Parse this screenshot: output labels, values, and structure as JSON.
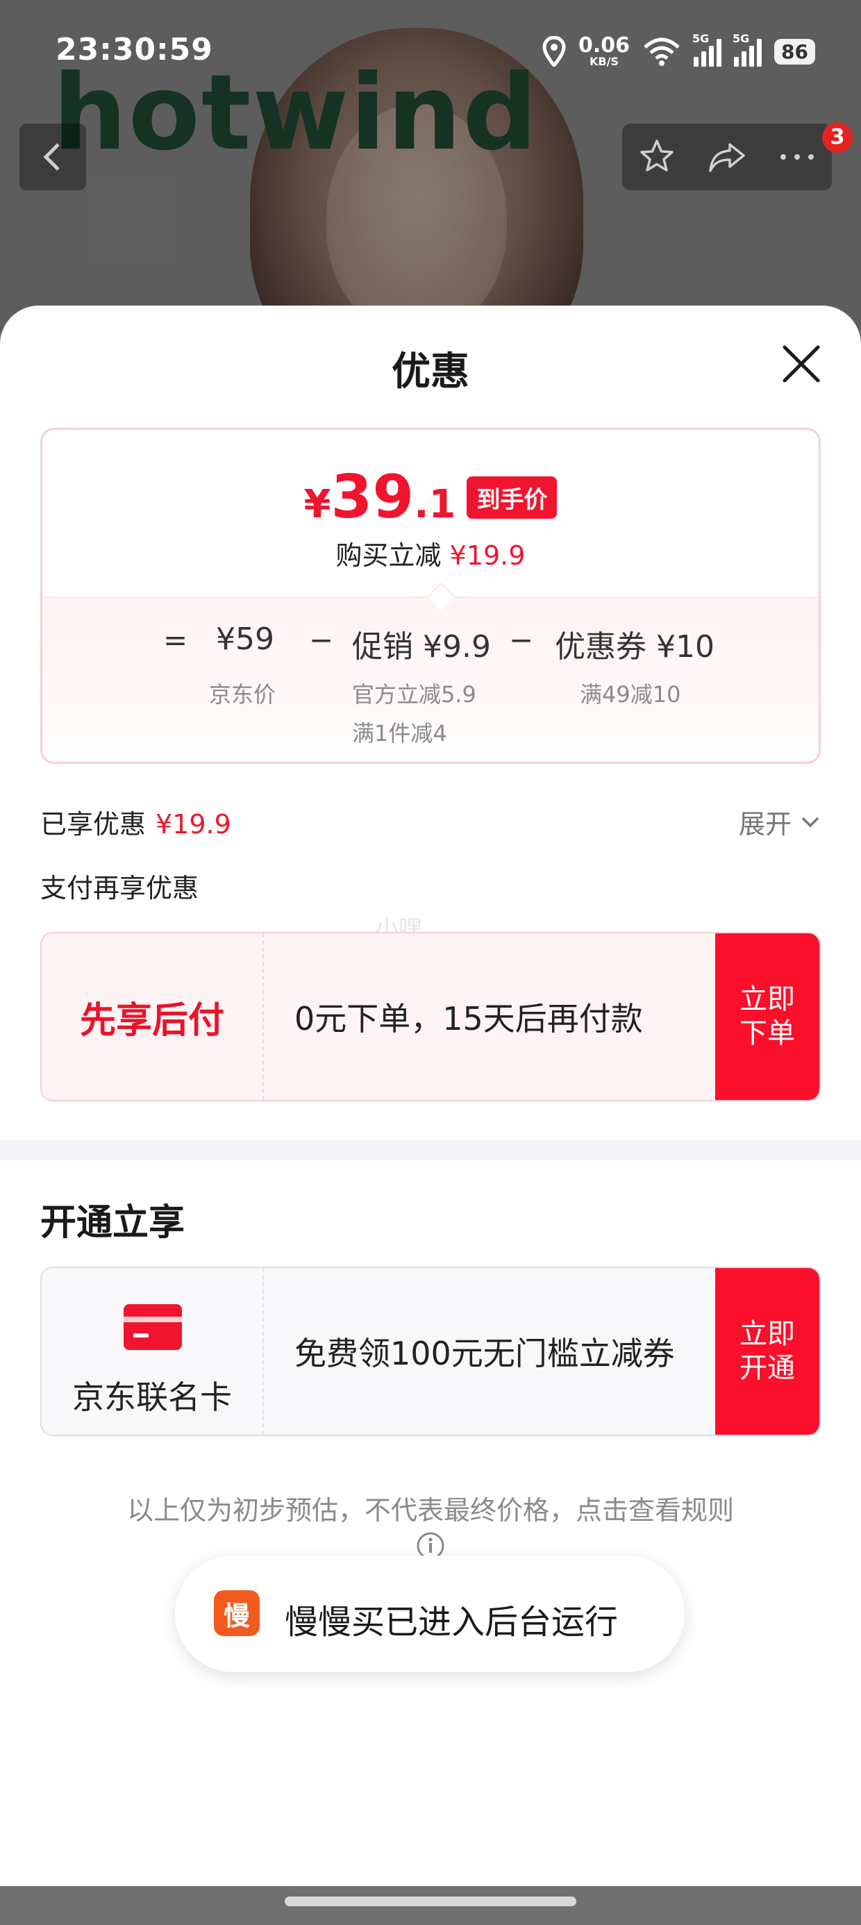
{
  "status": {
    "time": "23:30:59",
    "net_speed": "0.06",
    "net_unit": "KB/S",
    "signal1": "5G",
    "signal2": "5G",
    "battery": "86"
  },
  "background": {
    "brand": "hotwind",
    "badge_count": "3"
  },
  "sheet": {
    "title": "优惠"
  },
  "price": {
    "yen": "¥",
    "int": "39",
    "dec": ".1",
    "tag": "到手价",
    "sub_label": "购买立减",
    "sub_value": "¥19.9"
  },
  "breakdown": {
    "eq": "=",
    "jd_price": "¥59",
    "jd_label": "京东价",
    "minus1": "−",
    "promo": "促销 ¥9.9",
    "promo_note1": "官方立减5.9",
    "promo_note2": "满1件减4",
    "minus2": "−",
    "coupon": "优惠券 ¥10",
    "coupon_note": "满49减10"
  },
  "enjoyed": {
    "label": "已享优惠",
    "value": "¥19.9",
    "expand": "展开"
  },
  "pay_more": "支付再享优惠",
  "watermark": "小嘿",
  "pay_card": {
    "left": "先享后付",
    "mid": "0元下单，15天后再付款",
    "btn_line1": "立即",
    "btn_line2": "下单"
  },
  "open_section": {
    "title": "开通立享",
    "card_label": "京东联名卡",
    "mid": "免费领100元无门槛立减券",
    "btn_line1": "立即",
    "btn_line2": "开通"
  },
  "disclaimer": "以上仅为初步预估，不代表最终价格，点击查看规则",
  "toast": {
    "logo": "慢",
    "text": "慢慢买已进入后台运行"
  },
  "colors": {
    "accent": "#f0142f",
    "button": "#fb0f2b"
  }
}
